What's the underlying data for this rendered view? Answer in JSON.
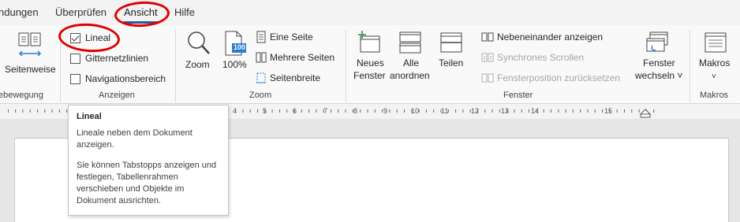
{
  "tabs": [
    {
      "label": "ndungen"
    },
    {
      "label": "Überprüfen"
    },
    {
      "label": "Ansicht"
    },
    {
      "label": "Hilfe"
    }
  ],
  "ribbon": {
    "seitenbewegung": {
      "button": "Seitenweise",
      "group_label": "ebewegung"
    },
    "anzeigen": {
      "items": [
        {
          "label": "Lineal",
          "checked": true
        },
        {
          "label": "Gitternetzlinien",
          "checked": false
        },
        {
          "label": "Navigationsbereich",
          "checked": false
        }
      ],
      "group_label": "Anzeigen"
    },
    "zoom": {
      "zoom_button": "Zoom",
      "hundred_button": "100%",
      "hundred_icon_text": "100",
      "eine_seite": "Eine Seite",
      "mehrere_seiten": "Mehrere Seiten",
      "seitenbreite": "Seitenbreite",
      "group_label": "Zoom"
    },
    "fenster": {
      "neues_fenster_1": "Neues",
      "neues_fenster_2": "Fenster",
      "alle_anordnen_1": "Alle",
      "alle_anordnen_2": "anordnen",
      "teilen": "Teilen",
      "nebeneinander": "Nebeneinander anzeigen",
      "synchrones": "Synchrones Scrollen",
      "fensterposition": "Fensterposition zurücksetzen",
      "wechseln_1": "Fenster",
      "wechseln_2": "wechseln ˅",
      "group_label": "Fenster"
    },
    "makros": {
      "button": "Makros",
      "chevron": "˅",
      "group_label": "Makros"
    }
  },
  "ruler": {
    "numbers": [
      "4",
      "5",
      "6",
      "7",
      "8",
      "9",
      "10",
      "11",
      "12",
      "13",
      "14",
      "15"
    ]
  },
  "tooltip": {
    "title": "Lineal",
    "body1": "Lineale neben dem Dokument anzeigen.",
    "body2": "Sie können Tabstopps anzeigen und festlegen, Tabellenrahmen verschieben und Objekte im Dokument ausrichten."
  },
  "colors": {
    "accent": "#2b579a",
    "annotation": "#e00000",
    "icon_blue": "#2b7cd3"
  }
}
